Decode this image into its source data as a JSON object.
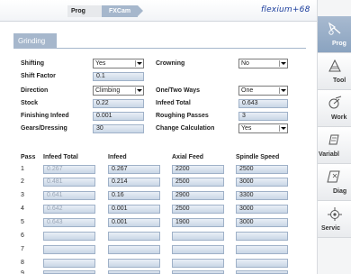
{
  "header": {
    "crumbs": [
      "Prog",
      "FXCam"
    ],
    "brand": "flexium+68"
  },
  "section": {
    "title": "Grinding"
  },
  "form": {
    "shifting": {
      "label": "Shifting",
      "value": "Yes"
    },
    "shift_factor": {
      "label": "Shift Factor",
      "value": "0.1"
    },
    "direction": {
      "label": "Direction",
      "value": "Climbing"
    },
    "stock": {
      "label": "Stock",
      "value": "0.22"
    },
    "finishing_infeed": {
      "label": "Finishing Infeed",
      "value": "0.001"
    },
    "gears_dressing": {
      "label": "Gears/Dressing",
      "value": "30"
    },
    "crowning": {
      "label": "Crowning",
      "value": "No"
    },
    "one_two_ways": {
      "label": "One/Two Ways",
      "value": "One"
    },
    "infeed_total": {
      "label": "Infeed Total",
      "value": "0.643"
    },
    "roughing_passes": {
      "label": "Roughing Passes",
      "value": "3"
    },
    "change_calculation": {
      "label": "Change Calculation",
      "value": "Yes"
    }
  },
  "table": {
    "headers": [
      "Pass",
      "Infeed Total",
      "Infeed",
      "Axial Feed",
      "Spindle Speed"
    ],
    "rows": [
      {
        "pass": "1",
        "infeed_total": "0.267",
        "infeed": "0.267",
        "axial_feed": "2200",
        "spindle_speed": "2500"
      },
      {
        "pass": "2",
        "infeed_total": "0.481",
        "infeed": "0.214",
        "axial_feed": "2500",
        "spindle_speed": "3000"
      },
      {
        "pass": "3",
        "infeed_total": "0.641",
        "infeed": "0.16",
        "axial_feed": "2900",
        "spindle_speed": "3300"
      },
      {
        "pass": "4",
        "infeed_total": "0.642",
        "infeed": "0.001",
        "axial_feed": "2500",
        "spindle_speed": "3000"
      },
      {
        "pass": "5",
        "infeed_total": "0.643",
        "infeed": "0.001",
        "axial_feed": "1900",
        "spindle_speed": "3000"
      },
      {
        "pass": "6",
        "infeed_total": "",
        "infeed": "",
        "axial_feed": "",
        "spindle_speed": ""
      },
      {
        "pass": "7",
        "infeed_total": "",
        "infeed": "",
        "axial_feed": "",
        "spindle_speed": ""
      },
      {
        "pass": "8",
        "infeed_total": "",
        "infeed": "",
        "axial_feed": "",
        "spindle_speed": ""
      },
      {
        "pass": "9",
        "infeed_total": "",
        "infeed": "",
        "axial_feed": "",
        "spindle_speed": ""
      }
    ]
  },
  "sidebar": {
    "items": [
      {
        "label": "Prog",
        "icon": "prog-icon",
        "active": true
      },
      {
        "label": "Tool",
        "icon": "tool-icon",
        "active": false
      },
      {
        "label": "Work",
        "icon": "work-icon",
        "active": false
      },
      {
        "label": "Variabl",
        "icon": "variables-icon",
        "active": false
      },
      {
        "label": "Diag",
        "icon": "diag-icon",
        "active": false
      },
      {
        "label": "Servic",
        "icon": "service-icon",
        "active": false
      }
    ]
  },
  "colors": {
    "accent": "#a6b7cc",
    "brand": "#1a3c9c",
    "field_fill": "#d4dfec"
  }
}
